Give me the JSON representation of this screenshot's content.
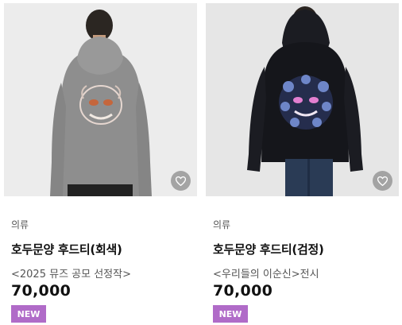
{
  "products": [
    {
      "category": "의류",
      "name": "호두문양 후드티(회색)",
      "subtitle": "<2025 뮤즈 공모 선정작>",
      "price": "70,000",
      "badge": "NEW",
      "hoodie_color": "#8e8e8e",
      "wishlist_icon": "heart-outline-icon"
    },
    {
      "category": "의류",
      "name": "호두문양 후드티(검정)",
      "subtitle": "<우리들의 이순신>전시",
      "price": "70,000",
      "badge": "NEW",
      "hoodie_color": "#15161b",
      "wishlist_icon": "heart-outline-icon"
    }
  ],
  "colors": {
    "badge_bg": "#b06bc8",
    "photo_bg": "#e9e9e9"
  }
}
